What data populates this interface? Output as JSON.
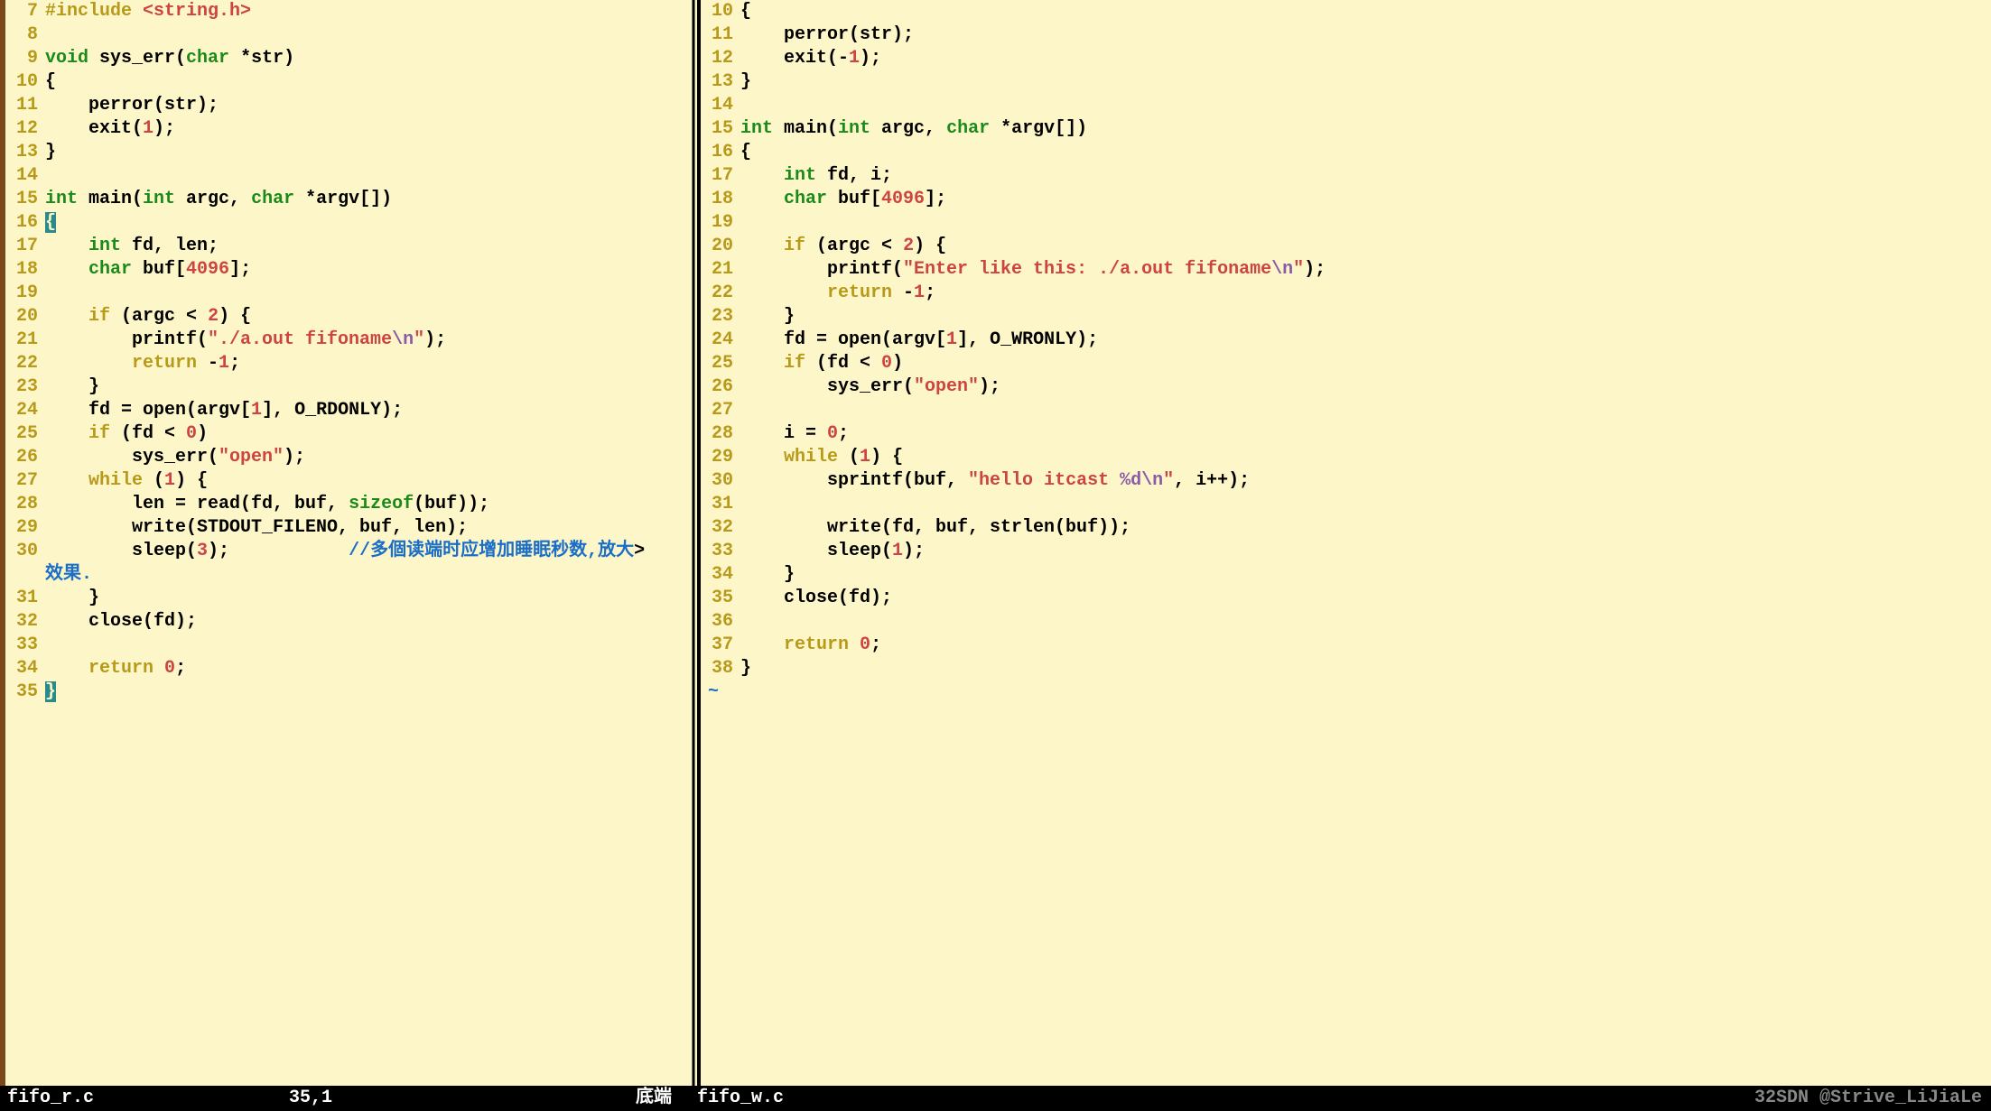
{
  "left": {
    "filename": "fifo_r.c",
    "cursor_pos": "35,1",
    "mode": "底端",
    "lines": [
      {
        "n": 7,
        "tokens": [
          {
            "t": "#include ",
            "c": "preproc-kw"
          },
          {
            "t": "<string.h>",
            "c": "string"
          }
        ]
      },
      {
        "n": 8,
        "tokens": []
      },
      {
        "n": 9,
        "tokens": [
          {
            "t": "void",
            "c": "kw-type"
          },
          {
            "t": " sys_err(",
            "c": "ident"
          },
          {
            "t": "char",
            "c": "kw-type"
          },
          {
            "t": " *str)",
            "c": "ident"
          }
        ]
      },
      {
        "n": 10,
        "tokens": [
          {
            "t": "{",
            "c": "ident"
          }
        ]
      },
      {
        "n": 11,
        "tokens": [
          {
            "t": "    perror(str);",
            "c": "ident"
          }
        ]
      },
      {
        "n": 12,
        "tokens": [
          {
            "t": "    exit(",
            "c": "ident"
          },
          {
            "t": "1",
            "c": "number"
          },
          {
            "t": ");",
            "c": "ident"
          }
        ]
      },
      {
        "n": 13,
        "tokens": [
          {
            "t": "}",
            "c": "ident"
          }
        ]
      },
      {
        "n": 14,
        "tokens": []
      },
      {
        "n": 15,
        "tokens": [
          {
            "t": "int",
            "c": "kw-type"
          },
          {
            "t": " main(",
            "c": "ident"
          },
          {
            "t": "int",
            "c": "kw-type"
          },
          {
            "t": " argc, ",
            "c": "ident"
          },
          {
            "t": "char",
            "c": "kw-type"
          },
          {
            "t": " *argv[])",
            "c": "ident"
          }
        ]
      },
      {
        "n": 16,
        "tokens": [
          {
            "t": "{",
            "c": "cursor"
          }
        ]
      },
      {
        "n": 17,
        "tokens": [
          {
            "t": "    ",
            "c": "ident"
          },
          {
            "t": "int",
            "c": "kw-type"
          },
          {
            "t": " fd, len;",
            "c": "ident"
          }
        ]
      },
      {
        "n": 18,
        "tokens": [
          {
            "t": "    ",
            "c": "ident"
          },
          {
            "t": "char",
            "c": "kw-type"
          },
          {
            "t": " buf[",
            "c": "ident"
          },
          {
            "t": "4096",
            "c": "number"
          },
          {
            "t": "];",
            "c": "ident"
          }
        ]
      },
      {
        "n": 19,
        "tokens": []
      },
      {
        "n": 20,
        "tokens": [
          {
            "t": "    ",
            "c": "ident"
          },
          {
            "t": "if",
            "c": "kw-ctrl"
          },
          {
            "t": " (argc < ",
            "c": "ident"
          },
          {
            "t": "2",
            "c": "number"
          },
          {
            "t": ") {",
            "c": "ident"
          }
        ]
      },
      {
        "n": 21,
        "tokens": [
          {
            "t": "        printf(",
            "c": "ident"
          },
          {
            "t": "\"./a.out fifoname",
            "c": "string"
          },
          {
            "t": "\\n",
            "c": "escape"
          },
          {
            "t": "\"",
            "c": "string"
          },
          {
            "t": ");",
            "c": "ident"
          }
        ]
      },
      {
        "n": 22,
        "tokens": [
          {
            "t": "        ",
            "c": "ident"
          },
          {
            "t": "return",
            "c": "kw-ctrl"
          },
          {
            "t": " -",
            "c": "ident"
          },
          {
            "t": "1",
            "c": "number"
          },
          {
            "t": ";",
            "c": "ident"
          }
        ]
      },
      {
        "n": 23,
        "tokens": [
          {
            "t": "    }",
            "c": "ident"
          }
        ]
      },
      {
        "n": 24,
        "tokens": [
          {
            "t": "    fd = open(argv[",
            "c": "ident"
          },
          {
            "t": "1",
            "c": "number"
          },
          {
            "t": "], O_RDONLY);",
            "c": "ident"
          }
        ]
      },
      {
        "n": 25,
        "tokens": [
          {
            "t": "    ",
            "c": "ident"
          },
          {
            "t": "if",
            "c": "kw-ctrl"
          },
          {
            "t": " (fd < ",
            "c": "ident"
          },
          {
            "t": "0",
            "c": "number"
          },
          {
            "t": ")",
            "c": "ident"
          }
        ]
      },
      {
        "n": 26,
        "tokens": [
          {
            "t": "        sys_err(",
            "c": "ident"
          },
          {
            "t": "\"open\"",
            "c": "string"
          },
          {
            "t": ");",
            "c": "ident"
          }
        ]
      },
      {
        "n": 27,
        "tokens": [
          {
            "t": "    ",
            "c": "ident"
          },
          {
            "t": "while",
            "c": "kw-ctrl"
          },
          {
            "t": " (",
            "c": "ident"
          },
          {
            "t": "1",
            "c": "number"
          },
          {
            "t": ") {",
            "c": "ident"
          }
        ]
      },
      {
        "n": 28,
        "tokens": [
          {
            "t": "        len = read(fd, buf, ",
            "c": "ident"
          },
          {
            "t": "sizeof",
            "c": "kw-type"
          },
          {
            "t": "(buf));",
            "c": "ident"
          }
        ]
      },
      {
        "n": 29,
        "tokens": [
          {
            "t": "        write(STDOUT_FILENO, buf, len);",
            "c": "ident"
          }
        ]
      },
      {
        "n": 30,
        "tokens": [
          {
            "t": "        sleep(",
            "c": "ident"
          },
          {
            "t": "3",
            "c": "number"
          },
          {
            "t": ");           ",
            "c": "ident"
          },
          {
            "t": "//多個读端时应增加睡眠秒数,放大",
            "c": "comment"
          },
          {
            "t": ">",
            "c": "trunc-marker"
          }
        ]
      },
      {
        "n": "",
        "tokens": [
          {
            "t": "效果.",
            "c": "comment"
          }
        ]
      },
      {
        "n": 31,
        "tokens": [
          {
            "t": "    }",
            "c": "ident"
          }
        ]
      },
      {
        "n": 32,
        "tokens": [
          {
            "t": "    close(fd);",
            "c": "ident"
          }
        ]
      },
      {
        "n": 33,
        "tokens": []
      },
      {
        "n": 34,
        "tokens": [
          {
            "t": "    ",
            "c": "ident"
          },
          {
            "t": "return",
            "c": "kw-ctrl"
          },
          {
            "t": " ",
            "c": "ident"
          },
          {
            "t": "0",
            "c": "number"
          },
          {
            "t": ";",
            "c": "ident"
          }
        ]
      },
      {
        "n": 35,
        "tokens": [
          {
            "t": "}",
            "c": "cursor"
          }
        ]
      }
    ]
  },
  "right": {
    "filename": "fifo_w.c",
    "end_text": "32SDN @Strive_LiJiaLe",
    "lines": [
      {
        "n": 10,
        "tokens": [
          {
            "t": "{",
            "c": "ident"
          }
        ]
      },
      {
        "n": 11,
        "tokens": [
          {
            "t": "    perror(str);",
            "c": "ident"
          }
        ]
      },
      {
        "n": 12,
        "tokens": [
          {
            "t": "    exit(-",
            "c": "ident"
          },
          {
            "t": "1",
            "c": "number"
          },
          {
            "t": ");",
            "c": "ident"
          }
        ]
      },
      {
        "n": 13,
        "tokens": [
          {
            "t": "}",
            "c": "ident"
          }
        ]
      },
      {
        "n": 14,
        "tokens": []
      },
      {
        "n": 15,
        "tokens": [
          {
            "t": "int",
            "c": "kw-type"
          },
          {
            "t": " main(",
            "c": "ident"
          },
          {
            "t": "int",
            "c": "kw-type"
          },
          {
            "t": " argc, ",
            "c": "ident"
          },
          {
            "t": "char",
            "c": "kw-type"
          },
          {
            "t": " *argv[])",
            "c": "ident"
          }
        ]
      },
      {
        "n": 16,
        "tokens": [
          {
            "t": "{",
            "c": "ident"
          }
        ]
      },
      {
        "n": 17,
        "tokens": [
          {
            "t": "    ",
            "c": "ident"
          },
          {
            "t": "int",
            "c": "kw-type"
          },
          {
            "t": " fd, i;",
            "c": "ident"
          }
        ]
      },
      {
        "n": 18,
        "tokens": [
          {
            "t": "    ",
            "c": "ident"
          },
          {
            "t": "char",
            "c": "kw-type"
          },
          {
            "t": " buf[",
            "c": "ident"
          },
          {
            "t": "4096",
            "c": "number"
          },
          {
            "t": "];",
            "c": "ident"
          }
        ]
      },
      {
        "n": 19,
        "tokens": []
      },
      {
        "n": 20,
        "tokens": [
          {
            "t": "    ",
            "c": "ident"
          },
          {
            "t": "if",
            "c": "kw-ctrl"
          },
          {
            "t": " (argc < ",
            "c": "ident"
          },
          {
            "t": "2",
            "c": "number"
          },
          {
            "t": ") {",
            "c": "ident"
          }
        ]
      },
      {
        "n": 21,
        "tokens": [
          {
            "t": "        printf(",
            "c": "ident"
          },
          {
            "t": "\"Enter like this: ./a.out fifoname",
            "c": "string"
          },
          {
            "t": "\\n",
            "c": "escape"
          },
          {
            "t": "\"",
            "c": "string"
          },
          {
            "t": ");",
            "c": "ident"
          }
        ]
      },
      {
        "n": 22,
        "tokens": [
          {
            "t": "        ",
            "c": "ident"
          },
          {
            "t": "return",
            "c": "kw-ctrl"
          },
          {
            "t": " -",
            "c": "ident"
          },
          {
            "t": "1",
            "c": "number"
          },
          {
            "t": ";",
            "c": "ident"
          }
        ]
      },
      {
        "n": 23,
        "tokens": [
          {
            "t": "    }",
            "c": "ident"
          }
        ]
      },
      {
        "n": 24,
        "tokens": [
          {
            "t": "    fd = open(argv[",
            "c": "ident"
          },
          {
            "t": "1",
            "c": "number"
          },
          {
            "t": "], O_WRONLY);",
            "c": "ident"
          }
        ]
      },
      {
        "n": 25,
        "tokens": [
          {
            "t": "    ",
            "c": "ident"
          },
          {
            "t": "if",
            "c": "kw-ctrl"
          },
          {
            "t": " (fd < ",
            "c": "ident"
          },
          {
            "t": "0",
            "c": "number"
          },
          {
            "t": ")",
            "c": "ident"
          }
        ]
      },
      {
        "n": 26,
        "tokens": [
          {
            "t": "        sys_err(",
            "c": "ident"
          },
          {
            "t": "\"open\"",
            "c": "string"
          },
          {
            "t": ");",
            "c": "ident"
          }
        ]
      },
      {
        "n": 27,
        "tokens": []
      },
      {
        "n": 28,
        "tokens": [
          {
            "t": "    i = ",
            "c": "ident"
          },
          {
            "t": "0",
            "c": "number"
          },
          {
            "t": ";",
            "c": "ident"
          }
        ]
      },
      {
        "n": 29,
        "tokens": [
          {
            "t": "    ",
            "c": "ident"
          },
          {
            "t": "while",
            "c": "kw-ctrl"
          },
          {
            "t": " (",
            "c": "ident"
          },
          {
            "t": "1",
            "c": "number"
          },
          {
            "t": ") {",
            "c": "ident"
          }
        ]
      },
      {
        "n": 30,
        "tokens": [
          {
            "t": "        sprintf(buf, ",
            "c": "ident"
          },
          {
            "t": "\"hello itcast ",
            "c": "string"
          },
          {
            "t": "%d",
            "c": "escape"
          },
          {
            "t": "\\n",
            "c": "escape"
          },
          {
            "t": "\"",
            "c": "string"
          },
          {
            "t": ", i++);",
            "c": "ident"
          }
        ]
      },
      {
        "n": 31,
        "tokens": []
      },
      {
        "n": 32,
        "tokens": [
          {
            "t": "        write(fd, buf, strlen(buf));",
            "c": "ident"
          }
        ]
      },
      {
        "n": 33,
        "tokens": [
          {
            "t": "        sleep(",
            "c": "ident"
          },
          {
            "t": "1",
            "c": "number"
          },
          {
            "t": ");",
            "c": "ident"
          }
        ]
      },
      {
        "n": 34,
        "tokens": [
          {
            "t": "    }",
            "c": "ident"
          }
        ]
      },
      {
        "n": 35,
        "tokens": [
          {
            "t": "    close(fd);",
            "c": "ident"
          }
        ]
      },
      {
        "n": 36,
        "tokens": []
      },
      {
        "n": 37,
        "tokens": [
          {
            "t": "    ",
            "c": "ident"
          },
          {
            "t": "return",
            "c": "kw-ctrl"
          },
          {
            "t": " ",
            "c": "ident"
          },
          {
            "t": "0",
            "c": "number"
          },
          {
            "t": ";",
            "c": "ident"
          }
        ]
      },
      {
        "n": 38,
        "tokens": [
          {
            "t": "}",
            "c": "ident"
          }
        ]
      }
    ],
    "tilde": "~"
  }
}
